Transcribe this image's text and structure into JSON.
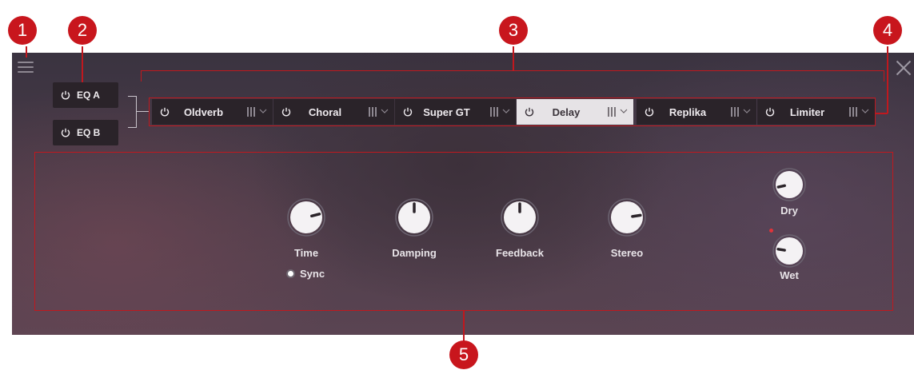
{
  "callouts": [
    "1",
    "2",
    "3",
    "4",
    "5"
  ],
  "eq_buttons": [
    {
      "label": "EQ A"
    },
    {
      "label": "EQ B"
    }
  ],
  "fx_slots": [
    {
      "label": "Oldverb",
      "active": false
    },
    {
      "label": "Choral",
      "active": false
    },
    {
      "label": "Super GT",
      "active": false
    },
    {
      "label": "Delay",
      "active": true
    },
    {
      "label": "Replika",
      "active": false
    },
    {
      "label": "Limiter",
      "active": false
    }
  ],
  "knobs": {
    "time": {
      "label": "Time",
      "value": 0.78
    },
    "damping": {
      "label": "Damping",
      "value": 0.5
    },
    "feedback": {
      "label": "Feedback",
      "value": 0.5
    },
    "stereo": {
      "label": "Stereo",
      "value": 0.8
    },
    "dry": {
      "label": "Dry",
      "value": 0.12
    },
    "wet": {
      "label": "Wet",
      "value": 0.2
    }
  },
  "sync_label": "Sync",
  "colors": {
    "callout": "#c8161d",
    "panel": "#3f3540",
    "slot": "#2a2329",
    "slot_active": "#e6e3e6"
  }
}
